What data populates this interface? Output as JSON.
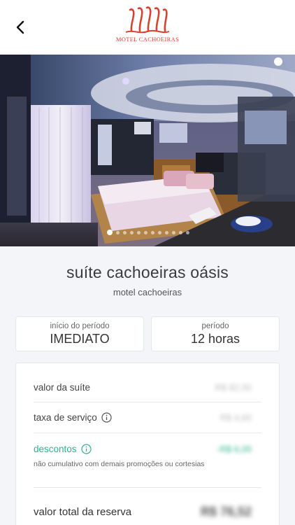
{
  "header": {
    "back_icon": "chevron-left-icon",
    "logo_text": "MOTEL CACHOEIRAS",
    "brand_color": "#d8432f"
  },
  "gallery": {
    "slide_count": 12,
    "active_index": 0
  },
  "suite": {
    "name": "suíte cachoeiras oásis",
    "motel": "motel cachoeiras"
  },
  "period_start": {
    "label": "início do período",
    "value": "IMEDIATO"
  },
  "period": {
    "label": "período",
    "value": "12 horas"
  },
  "pricing": {
    "suite_value_label": "valor da suíte",
    "suite_value": "R$ 82,00",
    "service_fee_label": "taxa de serviço",
    "service_fee": "R$ 4,60",
    "discounts_label": "descontos",
    "discounts": "-R$ 6,00",
    "discounts_note": "não cumulativo com demais promoções ou cortesias",
    "total_label": "valor total da reserva",
    "total": "R$ 76,52",
    "discount_color": "#2ab48b"
  }
}
